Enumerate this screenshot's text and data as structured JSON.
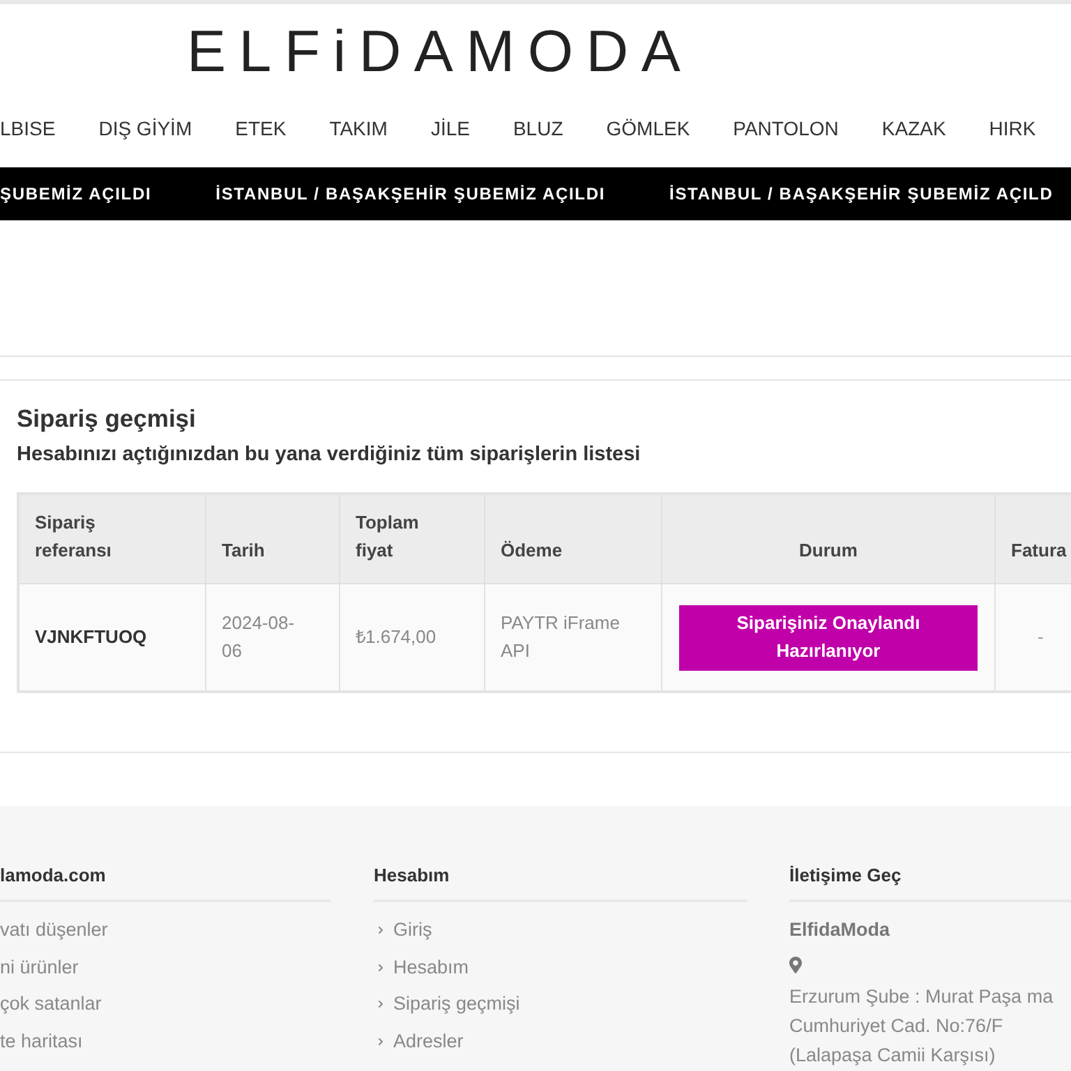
{
  "header": {
    "logo": "ELFiDAMODA"
  },
  "nav": [
    "LBISE",
    "DIŞ GİYİM",
    "ETEK",
    "TAKIM",
    "JİLE",
    "BLUZ",
    "GÖMLEK",
    "PANTOLON",
    "KAZAK",
    "HIRK"
  ],
  "announcement_bar": [
    "ŞUBEMİZ AÇILDI",
    "İSTANBUL / BAŞAKŞEHİR ŞUBEMİZ AÇILDI",
    "İSTANBUL / BAŞAKŞEHİR ŞUBEMİZ AÇILD"
  ],
  "page": {
    "title": "Sipariş geçmişi",
    "subtitle": "Hesabınızı açtığınızdan bu yana verdiğiniz tüm siparişlerin listesi"
  },
  "orders_table": {
    "columns": [
      "Sipariş referansı",
      "Tarih",
      "Toplam fiyat",
      "Ödeme",
      "Durum",
      "Fatura"
    ],
    "rows": [
      {
        "reference": "VJNKFTUOQ",
        "date": "2024-08-06",
        "total": "₺1.674,00",
        "payment": "PAYTR iFrame API",
        "status": {
          "label": "Siparişiniz Onaylandı Hazırlanıyor",
          "color": "#c000a8"
        },
        "invoice": "-"
      }
    ]
  },
  "footer": {
    "columns": [
      {
        "kind": "links",
        "heading": "lamoda.com",
        "items": [
          "vatı düşenler",
          "ni ürünler",
          "çok satanlar",
          "te haritası"
        ]
      },
      {
        "kind": "nav_links",
        "heading": "Hesabım",
        "items": [
          "Giriş",
          "Hesabım",
          "Sipariş geçmişi",
          "Adresler"
        ]
      },
      {
        "kind": "contact",
        "heading": "İletişime Geç",
        "company": "ElfidaModa",
        "address_lines": [
          "Erzurum Şube : Murat Paşa ma",
          "Cumhuriyet Cad. No:76/F",
          "(Lalapaşa Camii Karşısı)"
        ]
      }
    ]
  }
}
